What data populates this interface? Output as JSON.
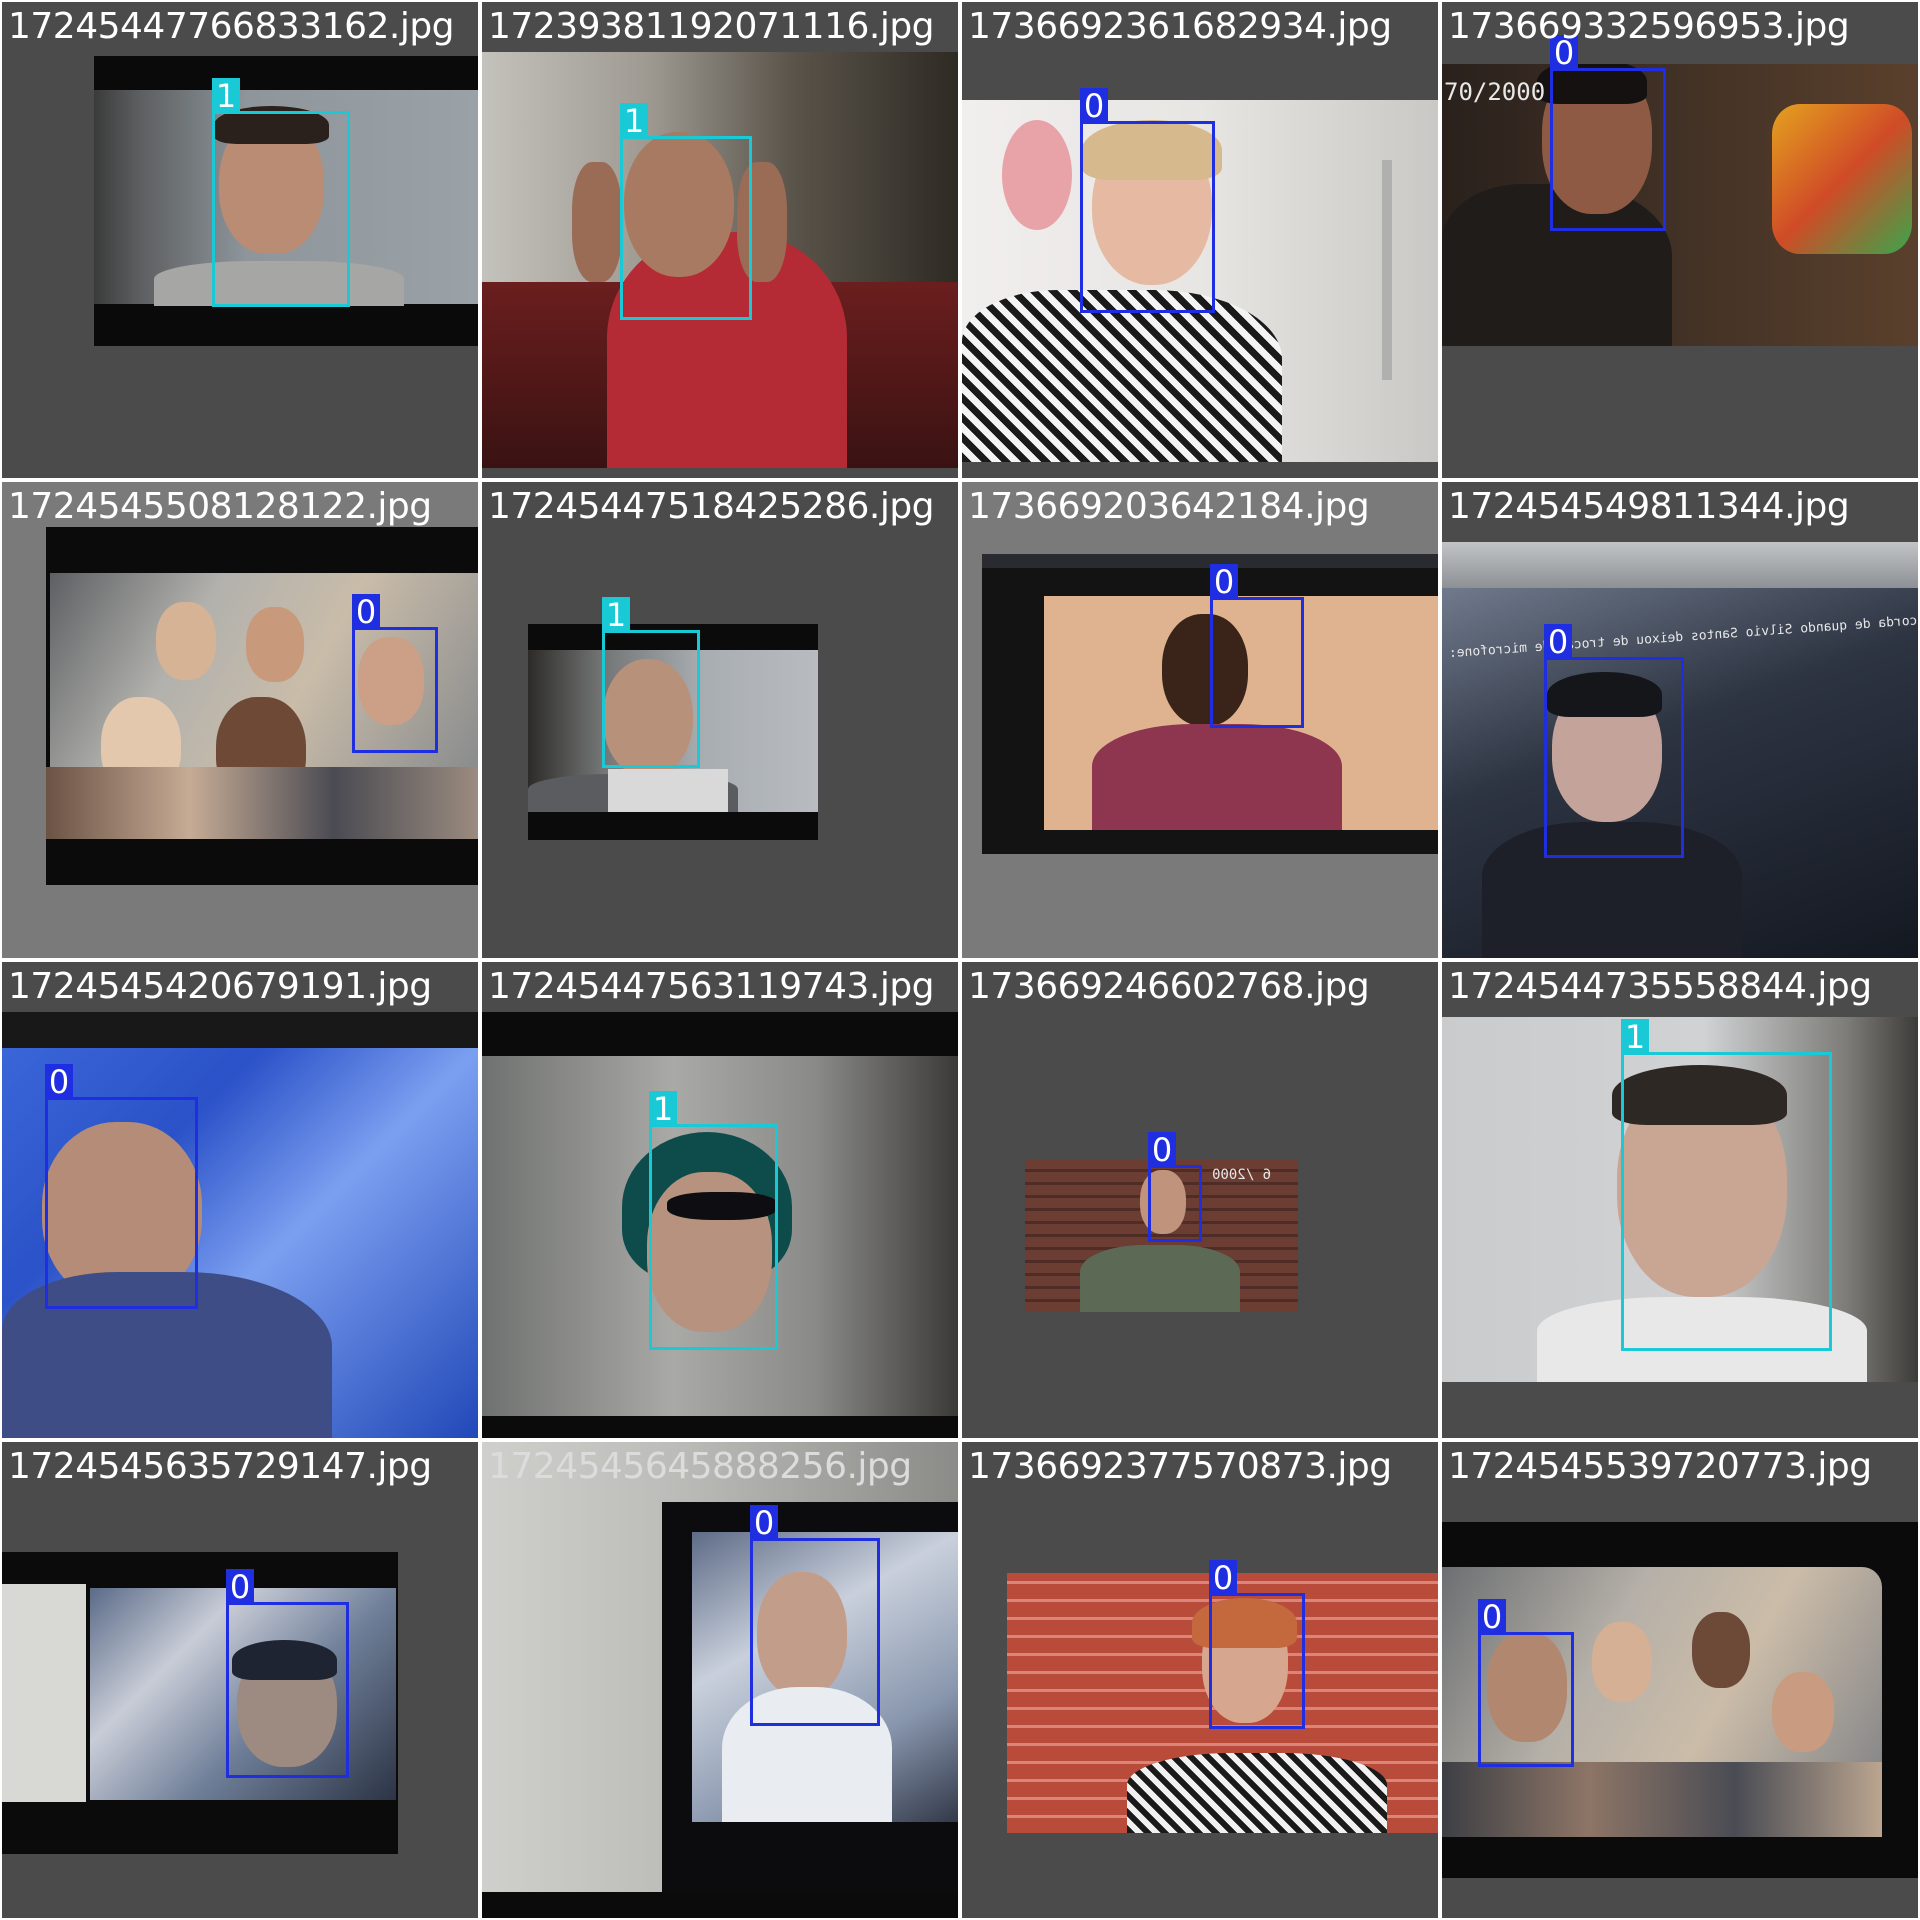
{
  "tiles": [
    {
      "file": "1724544776683316 2.jpg",
      "cls": "1"
    },
    {
      "file": "1723938119207111 6.jpg",
      "cls": "1"
    },
    {
      "file": "1736692361682934.jpg",
      "cls": "0"
    },
    {
      "file": "1736693325 96953.jpg",
      "cls": "0",
      "overlay": "70/2000"
    },
    {
      "file": "1724545508128122.jpg",
      "cls": "0"
    },
    {
      "file": "1724544751842528 6.jpg",
      "cls": "1"
    },
    {
      "file": "173669203642184.jpg",
      "cls": "0"
    },
    {
      "file": "172454549811344.jpg",
      "cls": "0",
      "overlay": "corda de quando Silvio Santos deixou de trocar de microfone: 'Não fala pra"
    },
    {
      "file": "1724545420679191.jpg",
      "cls": "0"
    },
    {
      "file": "1724544756311974 3.jpg",
      "cls": "1"
    },
    {
      "file": "173669246602768.jpg",
      "cls": "0",
      "overlay": "6 /2000"
    },
    {
      "file": "1724544735558844.jpg",
      "cls": "1"
    },
    {
      "file": "1724545635729147.jpg",
      "cls": "0"
    },
    {
      "file": "1724545645888256.jpg",
      "cls": "0"
    },
    {
      "file": "1736692377570873.jpg",
      "cls": "0"
    },
    {
      "file": "1724545539720773.jpg",
      "cls": "0"
    }
  ],
  "colors": {
    "class0": "#1f2ee0",
    "class1": "#19c9d6",
    "tile_bg": "#4b4b4b"
  }
}
